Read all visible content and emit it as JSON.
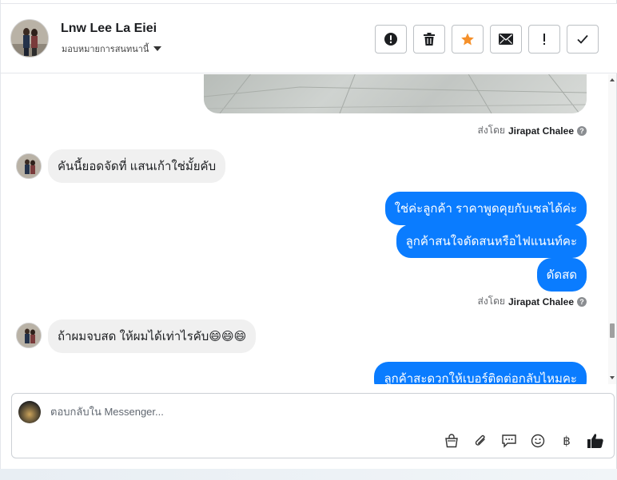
{
  "header": {
    "contact_name": "Lnw Lee La Eiei",
    "assign_label": "มอบหมายการสนทนานี้",
    "actions": [
      {
        "name": "alert-icon"
      },
      {
        "name": "trash-icon"
      },
      {
        "name": "star-icon",
        "color": "#f5902a"
      },
      {
        "name": "envelope-icon"
      },
      {
        "name": "exclamation-icon"
      },
      {
        "name": "checkmark-icon"
      }
    ]
  },
  "sent_by": {
    "prefix": "ส่งโดย",
    "agent": "Jirapat Chalee",
    "help": "?"
  },
  "messages": {
    "in_1": "คันนี้ยอดจัดที่ แสนเก้าใช่มั้ยคับ",
    "out_1": "ใช่ค่ะลูกค้า ราคาพูดคุยกับเซลได้ค่ะ",
    "out_2": "ลูกค้าสนใจดัดสนหรือไฟแนนท์คะ",
    "out_3": "ดัดสด",
    "in_2": "ถ้าผมจบสด ให้ผมได้เท่าไรคับ😄😄😄",
    "out_4": "ลูกค้าสะดวกให้เบอร์ติดต่อกลับไหมคะ"
  },
  "composer": {
    "placeholder": "ตอบกลับใน Messenger...",
    "tools": [
      "bag-icon",
      "paperclip-icon",
      "speech-bubble-icon",
      "smiley-icon",
      "baht-icon",
      "thumbs-up-icon"
    ],
    "baht_glyph": "฿"
  },
  "colors": {
    "outgoing_bubble": "#0a7cff",
    "incoming_bubble": "#f0f0f0",
    "star_accent": "#f5902a"
  }
}
